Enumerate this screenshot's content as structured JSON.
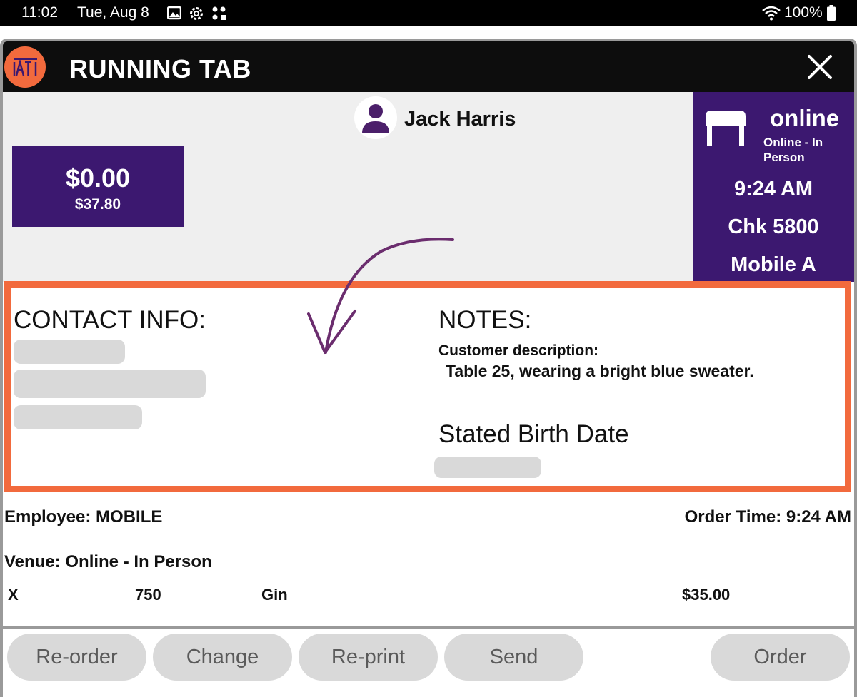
{
  "status_bar": {
    "time": "11:02",
    "date": "Tue, Aug 8",
    "battery": "100%"
  },
  "titlebar": {
    "logo_text": "TAT",
    "title": "RUNNING TAB"
  },
  "customer": {
    "name": "Jack Harris"
  },
  "balance": {
    "amount": "$0.00",
    "sub_amount": "$37.80"
  },
  "info_panel": {
    "mode": "online",
    "venue": "Online - In Person",
    "time": "9:24 AM",
    "check": "Chk 5800",
    "station": "Mobile  A"
  },
  "details": {
    "contact_title": "CONTACT INFO:",
    "notes_title": "NOTES:",
    "customer_description_label": "Customer description:",
    "customer_description": "Table 25, wearing a bright blue sweater.",
    "birth_date_title": "Stated Birth Date"
  },
  "order": {
    "employee": "Employee: MOBILE",
    "order_time": "Order Time: 9:24 AM",
    "venue": "Venue: Online - In Person",
    "items": [
      {
        "flag": "X",
        "quantity": "750",
        "name": "Gin",
        "price": "$35.00"
      }
    ]
  },
  "actions": {
    "reorder": "Re-order",
    "change": "Change",
    "reprint": "Re-print",
    "send": "Send",
    "order": "Order"
  },
  "colors": {
    "brand_orange": "#f26a3d",
    "purple": "#3c1870",
    "button_gray": "#d9d9d9",
    "arrow_purple": "#6b2d6e"
  }
}
